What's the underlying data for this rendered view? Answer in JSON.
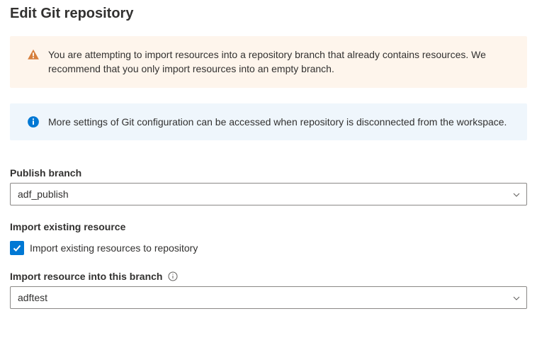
{
  "title": "Edit Git repository",
  "banners": {
    "warning": "You are attempting to import resources into a repository branch that already contains resources. We recommend that you only import resources into an empty branch.",
    "info": "More settings of Git configuration can be accessed when repository is disconnected from the workspace."
  },
  "fields": {
    "publish_branch": {
      "label": "Publish branch",
      "value": "adf_publish"
    },
    "import_existing": {
      "section_label": "Import existing resource",
      "checkbox_label": "Import existing resources to repository",
      "checked": true
    },
    "import_branch": {
      "label": "Import resource into this branch",
      "value": "adftest"
    }
  },
  "icons": {
    "warning": "warning-triangle",
    "info": "info-circle",
    "help": "info-outline",
    "chevron": "chevron-down",
    "check": "checkmark"
  },
  "colors": {
    "warning_icon": "#D67F3C",
    "info_icon": "#0078D4",
    "checkbox_bg": "#0078D4"
  }
}
